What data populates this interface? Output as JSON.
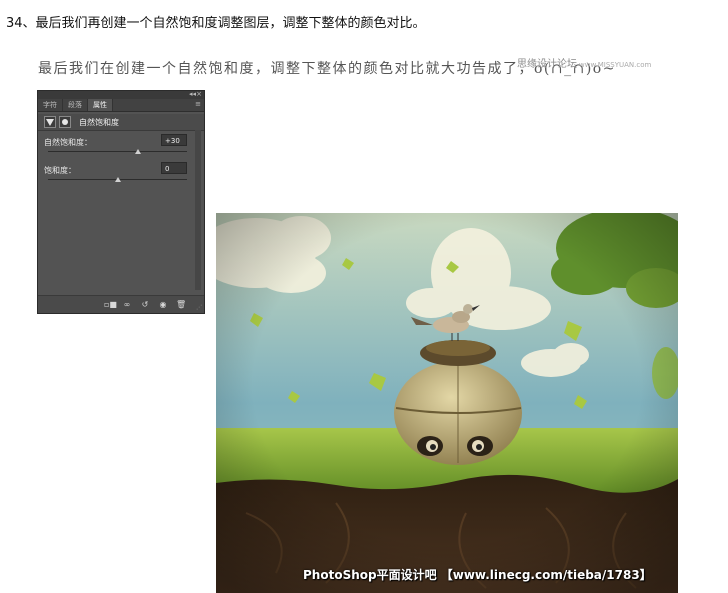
{
  "step_heading": "34、最后我们再创建一个自然饱和度调整图层，调整下整体的颜色对比。",
  "handwritten_note": "最后我们在创建一个自然饱和度，调整下整体的颜色对比就大功告成了，o(∩_∩)o~",
  "watermark_top": {
    "text": "思缘设计论坛",
    "url": "www.MISSYUAN.com"
  },
  "panel": {
    "tabs": [
      "字符",
      "段落",
      "属性"
    ],
    "active_tab": "属性",
    "layer_title": "自然饱和度",
    "vibrance": {
      "label": "自然饱和度：",
      "value": "+30",
      "slider_fraction": 0.65
    },
    "saturation": {
      "label": "饱和度：",
      "value": "0",
      "slider_fraction": 0.5
    },
    "footer_icons": [
      "clip-to-layer-icon",
      "view-previous-icon",
      "reset-icon",
      "visibility-icon",
      "delete-icon"
    ]
  },
  "artwork": {
    "caption": "PhotoShop平面设计吧 【www.linecg.com/tieba/1783】"
  },
  "colors": {
    "panel_bg": "#535353",
    "sky": "#8ab9c2",
    "grass": "#8cb13a",
    "soil": "#3a2616"
  }
}
